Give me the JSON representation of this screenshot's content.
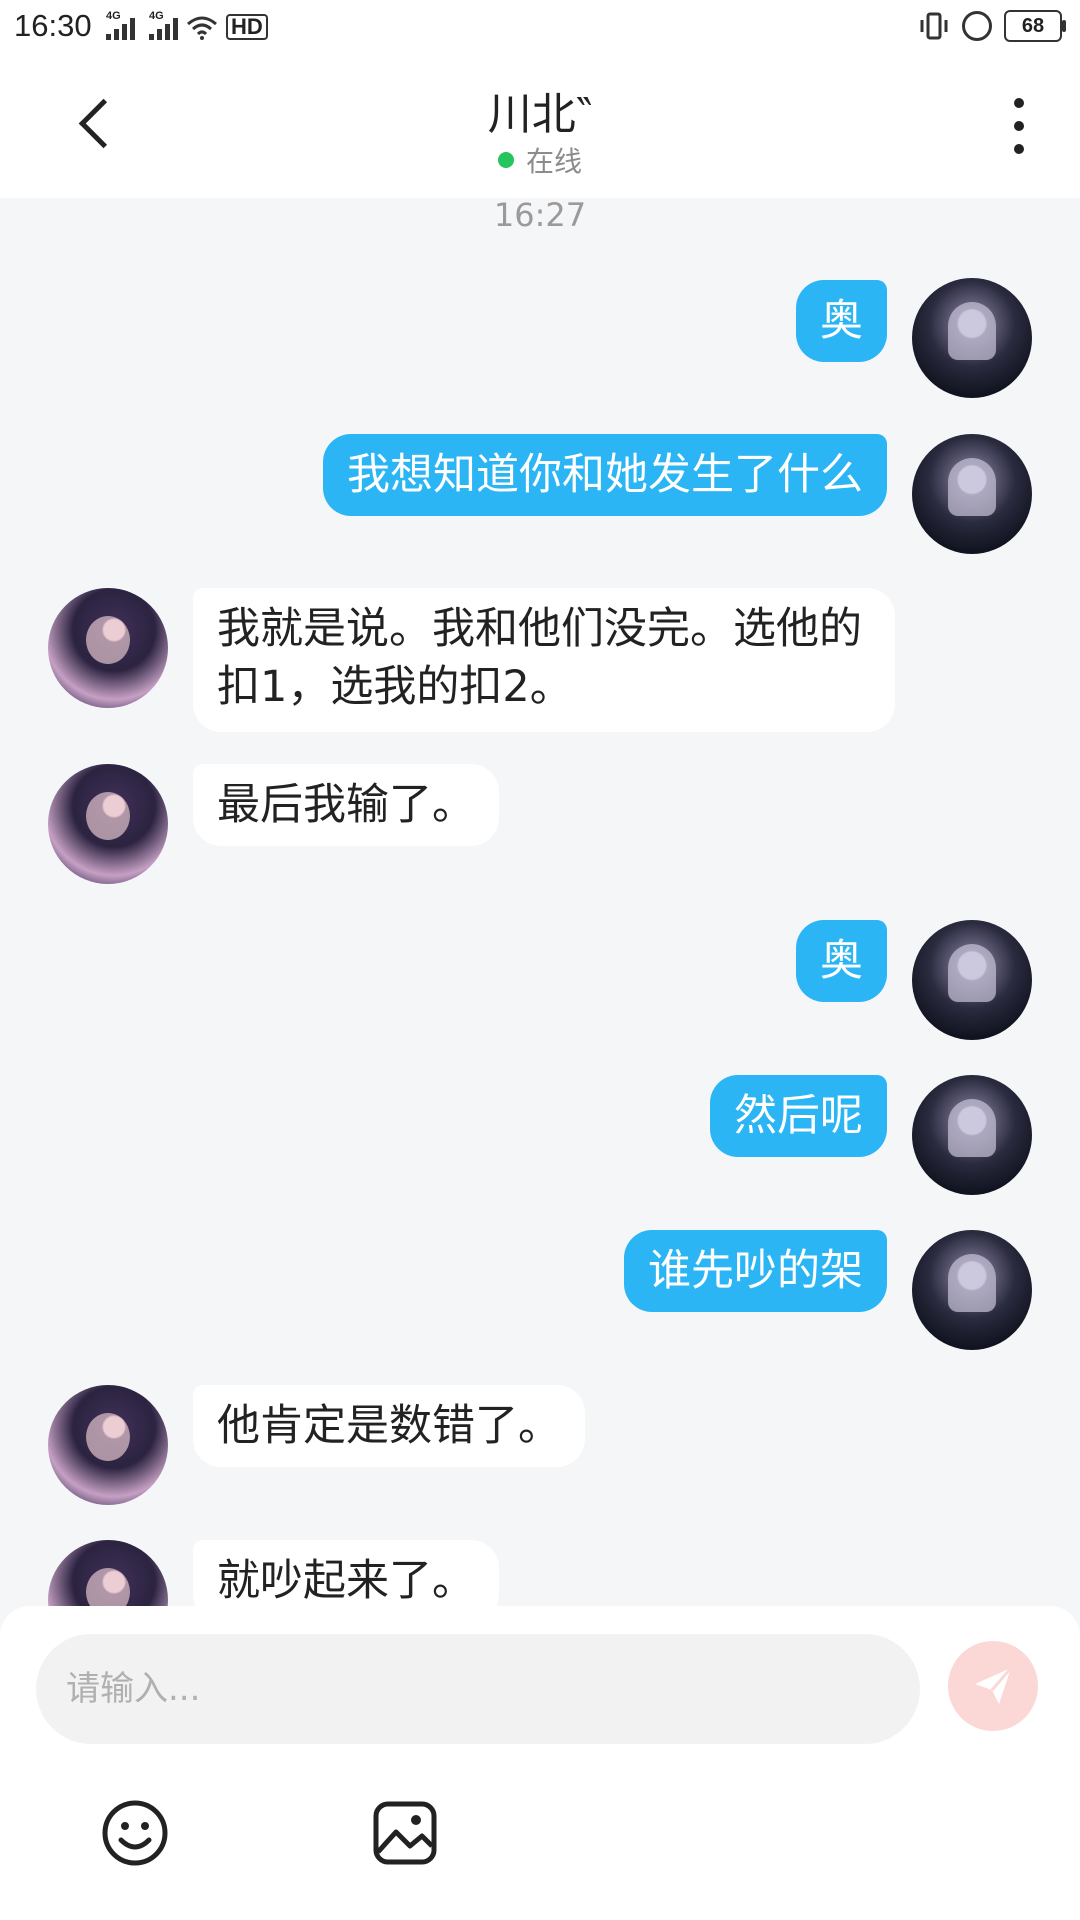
{
  "status_bar": {
    "time": "16:30",
    "net1": "4G",
    "net2": "4G",
    "hd_label": "HD",
    "battery": "68"
  },
  "header": {
    "back_icon": "chevron-left-icon",
    "title": "川北‶",
    "presence": "在线",
    "more_icon": "more-vertical-icon"
  },
  "chat": {
    "timestamp": "16:27",
    "messages": [
      {
        "side": "me",
        "text": "奥"
      },
      {
        "side": "me",
        "text": "我想知道你和她发生了什么"
      },
      {
        "side": "other",
        "text": "我就是说。我和他们没完。选他的扣1，选我的扣2。"
      },
      {
        "side": "other",
        "text": "最后我输了。"
      },
      {
        "side": "me",
        "text": "奥"
      },
      {
        "side": "me",
        "text": "然后呢"
      },
      {
        "side": "me",
        "text": "谁先吵的架"
      },
      {
        "side": "other",
        "text": "他肯定是数错了。"
      },
      {
        "side": "other",
        "text": "就吵起来了。"
      }
    ]
  },
  "composer": {
    "placeholder": "请输入...",
    "send_icon": "paper-plane-icon",
    "tools": [
      "emoji-icon",
      "image-icon"
    ]
  },
  "colors": {
    "bubble_me": "#2cb5f5",
    "bubble_other": "#ffffff",
    "online": "#22c55e",
    "send_bg": "#fbd8d6"
  }
}
